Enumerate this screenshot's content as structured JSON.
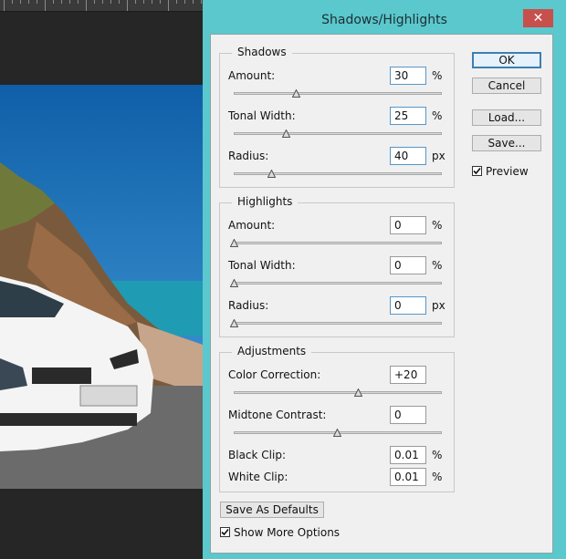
{
  "dialog": {
    "title": "Shadows/Highlights",
    "close_label": "✕",
    "accent_color": "#5ac8cc"
  },
  "shadows": {
    "title": "Shadows",
    "amount": {
      "label": "Amount:",
      "value": "30",
      "unit": "%",
      "level": 0.3
    },
    "tonal_width": {
      "label": "Tonal Width:",
      "value": "25",
      "unit": "%",
      "level": 0.25
    },
    "radius": {
      "label": "Radius:",
      "value": "40",
      "unit": "px",
      "level": 0.18
    }
  },
  "highlights": {
    "title": "Highlights",
    "amount": {
      "label": "Amount:",
      "value": "0",
      "unit": "%",
      "level": 0.0
    },
    "tonal_width": {
      "label": "Tonal Width:",
      "value": "0",
      "unit": "%",
      "level": 0.0
    },
    "radius": {
      "label": "Radius:",
      "value": "0",
      "unit": "px",
      "level": 0.0
    }
  },
  "adjustments": {
    "title": "Adjustments",
    "color_correction": {
      "label": "Color Correction:",
      "value": "+20",
      "level": 0.6
    },
    "midtone_contrast": {
      "label": "Midtone Contrast:",
      "value": "0",
      "level": 0.5
    },
    "black_clip": {
      "label": "Black Clip:",
      "value": "0.01",
      "unit": "%"
    },
    "white_clip": {
      "label": "White Clip:",
      "value": "0.01",
      "unit": "%"
    }
  },
  "buttons": {
    "ok": "OK",
    "cancel": "Cancel",
    "load": "Load...",
    "save": "Save...",
    "save_defaults": "Save As Defaults"
  },
  "options": {
    "preview_label": "Preview",
    "preview_checked": true,
    "show_more_label": "Show More Options",
    "show_more_checked": true
  }
}
